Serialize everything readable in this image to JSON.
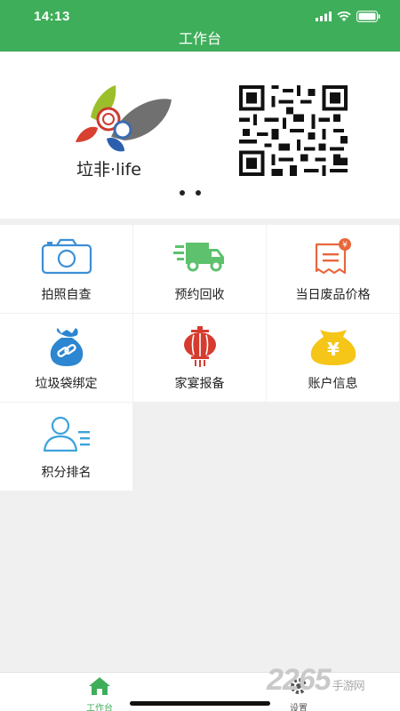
{
  "status_bar": {
    "time": "14:13"
  },
  "header": {
    "title": "工作台"
  },
  "banner": {
    "brand": "垃非·life"
  },
  "menu": [
    {
      "label": "拍照自查",
      "icon": "camera-icon"
    },
    {
      "label": "预约回收",
      "icon": "truck-icon"
    },
    {
      "label": "当日废品价格",
      "icon": "price-tag-icon"
    },
    {
      "label": "垃圾袋绑定",
      "icon": "bag-link-icon"
    },
    {
      "label": "家宴报备",
      "icon": "lantern-icon"
    },
    {
      "label": "账户信息",
      "icon": "money-bag-icon"
    },
    {
      "label": "积分排名",
      "icon": "user-list-icon"
    }
  ],
  "tabbar": {
    "items": [
      {
        "label": "工作台",
        "icon": "home-icon",
        "active": true
      },
      {
        "label": "设置",
        "icon": "gear-icon",
        "active": false
      }
    ]
  },
  "watermark": {
    "number": "2265",
    "suffix": "手游网"
  },
  "colors": {
    "primary": "#3fae5a",
    "blue": "#3b8fd6",
    "orange": "#e8673c",
    "red": "#d63b2f",
    "yellow": "#f5c518"
  }
}
